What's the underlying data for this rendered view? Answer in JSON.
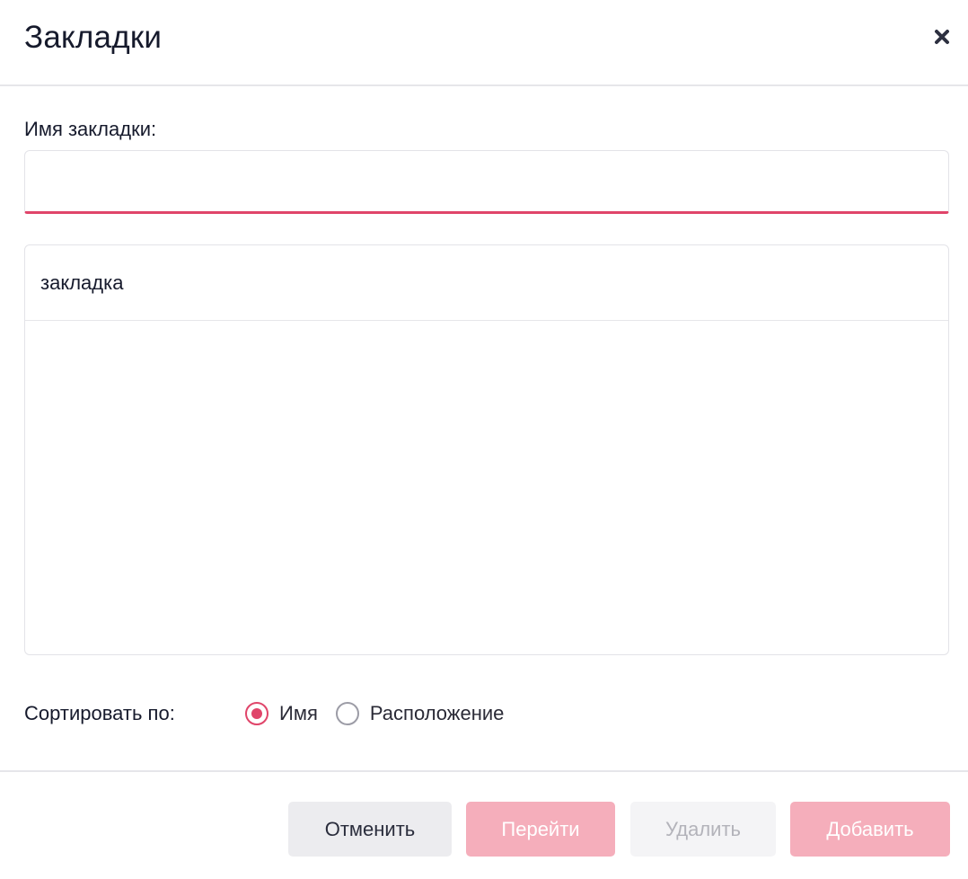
{
  "dialog": {
    "title": "Закладки",
    "close_icon": "close-icon"
  },
  "name_field": {
    "label": "Имя закладки:",
    "value": "",
    "placeholder": "",
    "accent_color": "#e0456a"
  },
  "bookmarks": {
    "items": [
      {
        "label": "закладка"
      }
    ]
  },
  "sort": {
    "label": "Сортировать по:",
    "options": [
      {
        "label": "Имя",
        "checked": true
      },
      {
        "label": "Расположение",
        "checked": false
      }
    ]
  },
  "buttons": {
    "cancel": "Отменить",
    "goto": "Перейти",
    "delete": "Удалить",
    "add": "Добавить"
  },
  "colors": {
    "accent": "#e0456a",
    "accent_disabled": "#f5aebb",
    "secondary_bg": "#ececef"
  }
}
